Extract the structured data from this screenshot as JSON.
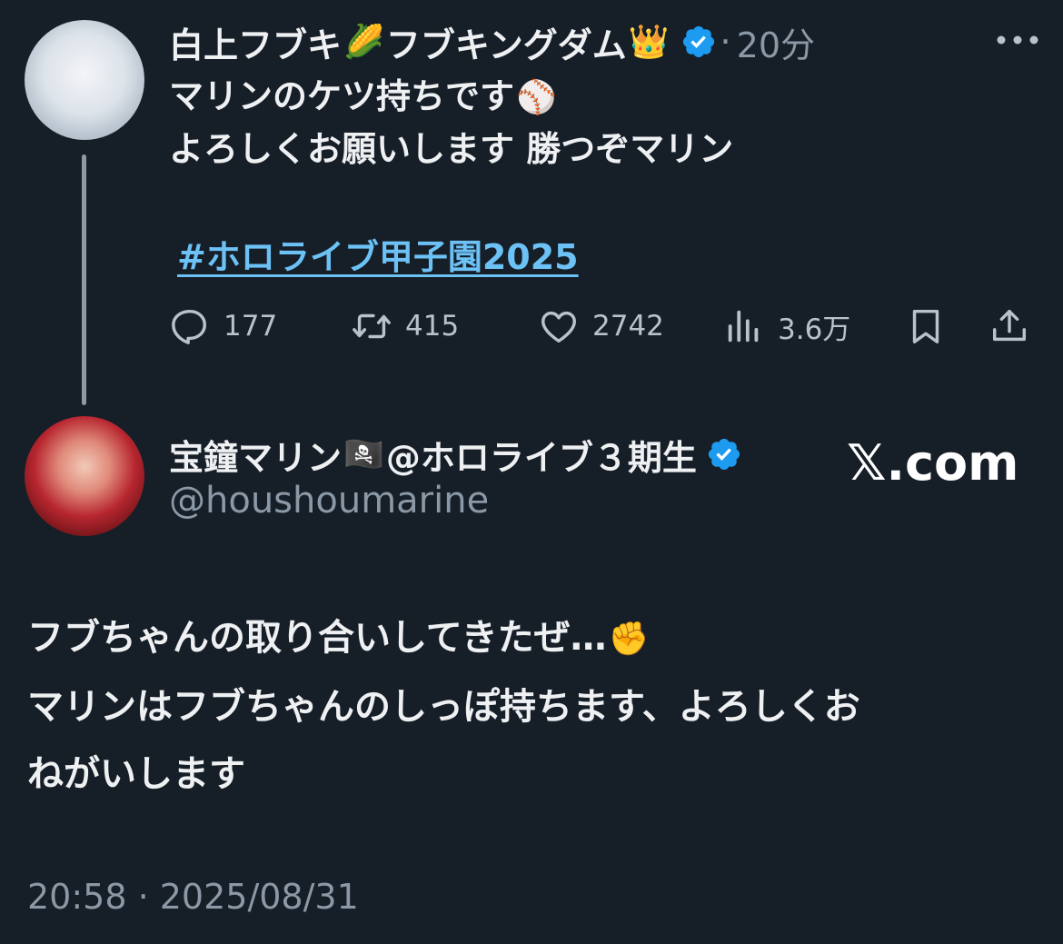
{
  "tweet1": {
    "display_name": "白上フブキ",
    "name_emoji_1": "🌽",
    "name_suffix": "フブキングダム",
    "name_emoji_2": "👑",
    "separator": "·",
    "time_ago": "20分",
    "line1": "マリンのケツ持ちです",
    "line1_emoji": "⚾",
    "line2": "よろしくお願いします 勝つぞマリン",
    "hashtag": "#ホロライブ甲子園2025",
    "replies": "177",
    "retweets": "415",
    "likes": "2742",
    "views": "3.6万"
  },
  "tweet2": {
    "display_name": "宝鐘マリン",
    "name_emoji": "🏴‍☠️",
    "name_suffix": "@ホロライブ３期生",
    "handle": "@houshoumarine",
    "line1": "フブちゃんの取り合いしてきたぜ…",
    "line1_emoji": "✊",
    "line2": "マリンはフブちゃんのしっぽ持ちます、よろしくお",
    "line3": "ねがいします",
    "timestamp": "20:58 · 2025/08/31"
  },
  "watermark": "𝕏.com",
  "icons": [
    "verified-badge-icon",
    "more-icon",
    "reply-icon",
    "retweet-icon",
    "like-icon",
    "views-icon",
    "bookmark-icon",
    "share-icon"
  ],
  "colors": {
    "background": "#161e28",
    "verified": "#1d9bf0",
    "link": "#6cc1f5",
    "muted": "#8b98a5"
  }
}
